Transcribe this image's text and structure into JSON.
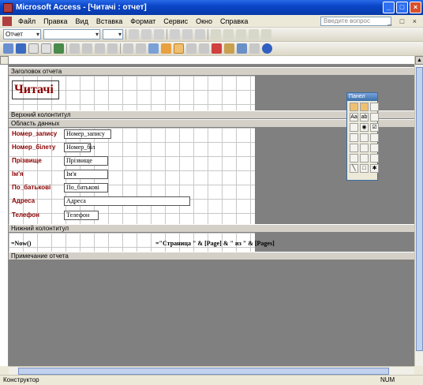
{
  "window": {
    "title": "Microsoft Access - [Читачі : отчет]"
  },
  "menu": {
    "items": [
      "Файл",
      "Правка",
      "Вид",
      "Вставка",
      "Формат",
      "Сервис",
      "Окно",
      "Справка"
    ],
    "help_placeholder": "Введите вопрос"
  },
  "toolbar": {
    "object_combo": "Отчет"
  },
  "sections": {
    "report_header": "Заголовок отчета",
    "page_header": "Верхний колонтитул",
    "detail": "Область данных",
    "page_footer": "Нижний колонтитул",
    "report_footer": "Примечание отчета"
  },
  "report": {
    "title": "Читачі"
  },
  "fields": [
    {
      "label": "Номер_запису",
      "value": "Номер_запису"
    },
    {
      "label": "Номер_білету",
      "value": "Номер_біл"
    },
    {
      "label": "Прізвище",
      "value": "Прізвище"
    },
    {
      "label": "Ім'я",
      "value": "Ім'я"
    },
    {
      "label": "По_батькові",
      "value": "По_батькові"
    },
    {
      "label": "Адреса",
      "value": "Адреса"
    },
    {
      "label": "Телефон",
      "value": "Телефон"
    }
  ],
  "footer": {
    "now_expr": "=Now()",
    "page_expr": "=\"Страница \" & [Page] & \" из \" & [Pages]"
  },
  "toolbox": {
    "title": "Панел"
  },
  "status": {
    "mode": "Конструктор",
    "num": "NUM"
  },
  "colors": {
    "label_text": "#8b0000",
    "title_bar": "#0a46c8",
    "canvas_bg": "#808080"
  }
}
